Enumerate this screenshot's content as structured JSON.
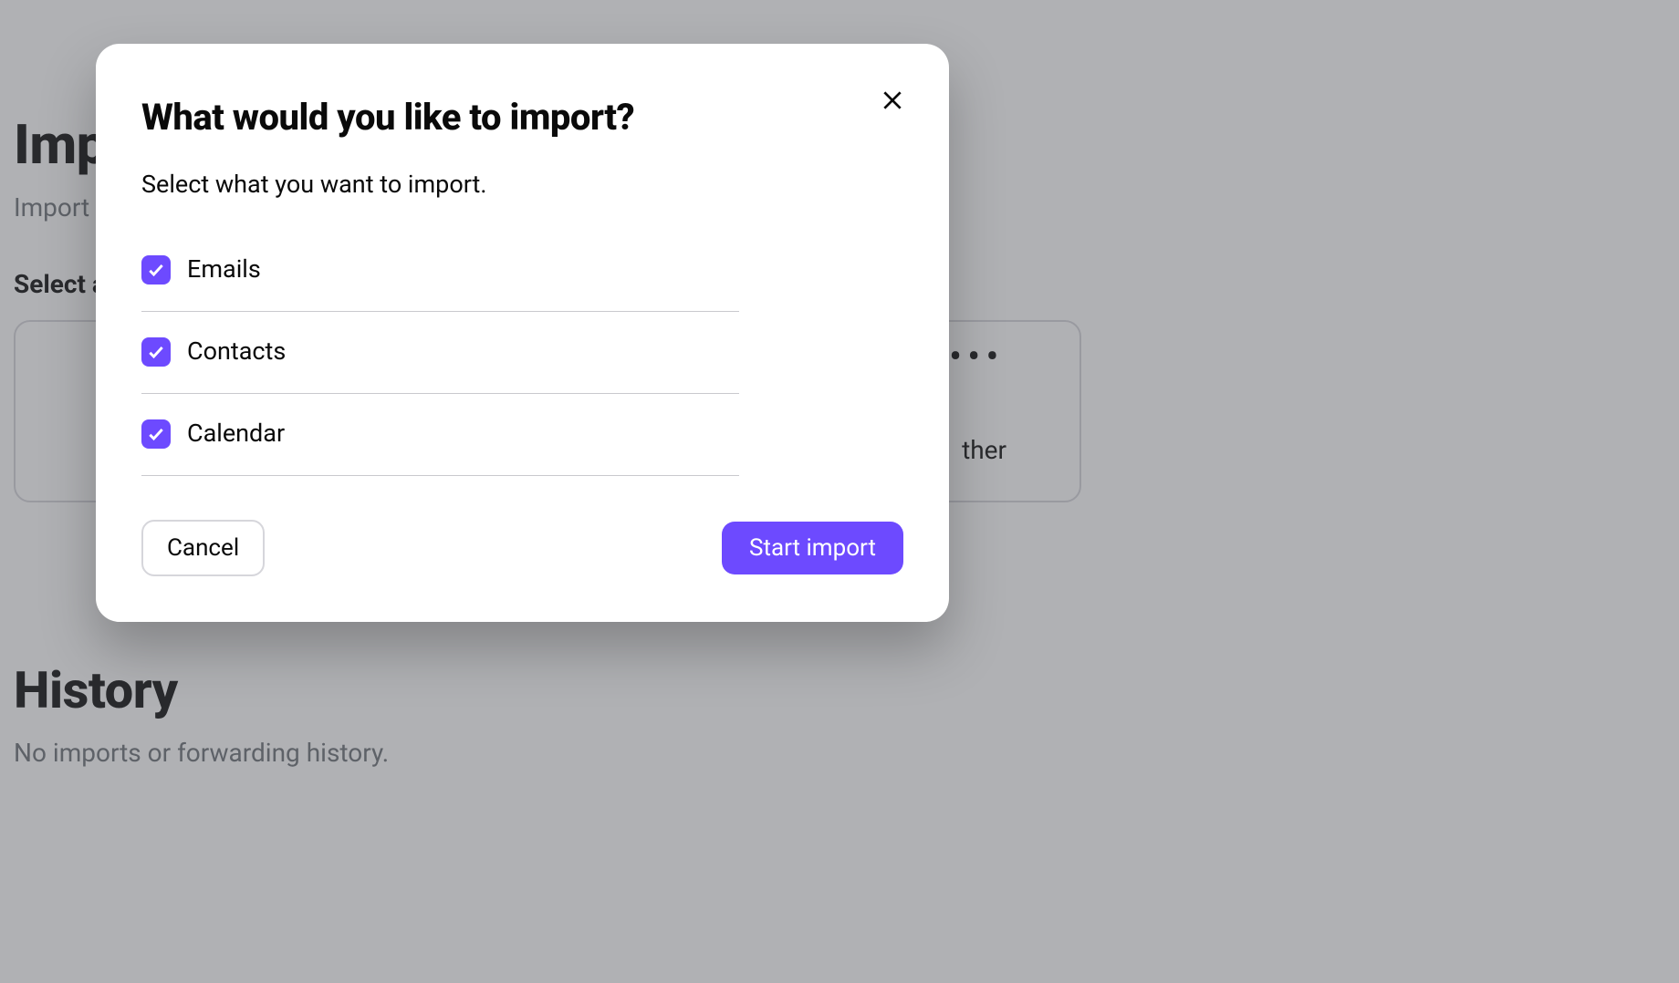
{
  "page": {
    "title": "Import",
    "subtitle": "Import your",
    "select_label": "Select a",
    "provider_other": "ther",
    "history_title": "History",
    "history_empty": "No imports or forwarding history."
  },
  "modal": {
    "title": "What would you like to import?",
    "description": "Select what you want to import.",
    "options": [
      {
        "label": "Emails",
        "checked": true
      },
      {
        "label": "Contacts",
        "checked": true
      },
      {
        "label": "Calendar",
        "checked": true
      }
    ],
    "cancel_label": "Cancel",
    "start_label": "Start import"
  },
  "colors": {
    "accent": "#6d4aff"
  }
}
